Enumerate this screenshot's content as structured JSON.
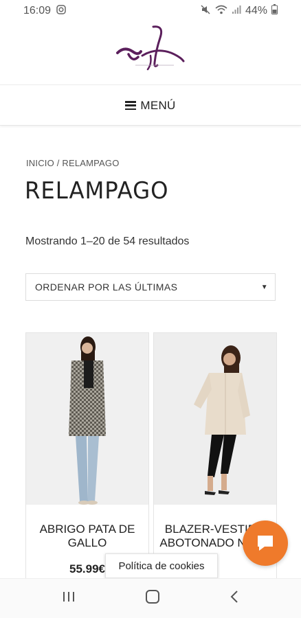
{
  "status_bar": {
    "time": "16:09",
    "battery": "44%",
    "icons": [
      "instagram-icon",
      "mute-icon",
      "wifi-icon",
      "signal-icon",
      "battery-icon"
    ]
  },
  "header": {
    "logo_name": "brand-logo"
  },
  "menu": {
    "label": "MENÚ"
  },
  "breadcrumb": {
    "text": "INICIO / RELAMPAGO"
  },
  "page": {
    "title": "RELAMPAGO",
    "results": "Mostrando 1–20 de 54 resultados"
  },
  "sort": {
    "selected": "ORDENAR POR LAS ÚLTIMAS"
  },
  "products": [
    {
      "title": "ABRIGO PATA DE GALLO",
      "price": "55.99€"
    },
    {
      "title": "BLAZER-VESTIDO ABOTONADO NUDE",
      "price": ""
    }
  ],
  "cookie": {
    "label": "Política de cookies"
  },
  "colors": {
    "accent": "#ef7a2b",
    "logo": "#5b1f5c"
  }
}
